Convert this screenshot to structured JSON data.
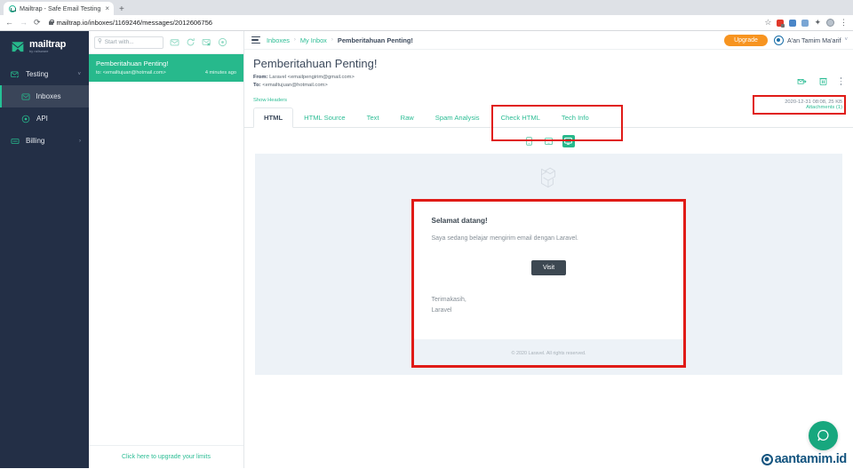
{
  "browser": {
    "tab_title": "Mailtrap - Safe Email Testing",
    "tab_close": "×",
    "new_tab": "+",
    "back": "←",
    "forward": "→",
    "reload": "⟳",
    "url": "mailtrap.io/inboxes/1169246/messages/2012606756",
    "star": "☆",
    "puzzle": "✦",
    "kebab": "⋮",
    "icons": [
      "lock-icon",
      "star-icon",
      "extension-red-icon",
      "extension-blue-icon",
      "extension-person-icon",
      "puzzle-icon",
      "profile-avatar-icon",
      "chrome-menu-icon"
    ]
  },
  "sidebar": {
    "logo_text": "mailtrap",
    "logo_sub": "by railsware",
    "items": [
      {
        "label": "Testing",
        "icon": "envelope-check-icon",
        "caret": "˅",
        "active": false
      },
      {
        "label": "Inboxes",
        "icon": "inbox-envelope-icon",
        "active": true
      },
      {
        "label": "API",
        "icon": "api-target-icon",
        "active": false
      },
      {
        "label": "Billing",
        "icon": "billing-card-icon",
        "caret": "›",
        "active": false
      }
    ]
  },
  "message_list": {
    "search_placeholder": "Start with...",
    "search_value": "",
    "toolbar_icons": [
      "mark-all-read-icon",
      "refresh-icon",
      "delete-all-icon",
      "inbox-settings-icon"
    ],
    "items": [
      {
        "subject": "Pemberitahuan Penting!",
        "recipient": "to: <emailtujuan@hotmail.com>",
        "time": "4 minutes ago"
      }
    ],
    "upgrade_link": "Click here to upgrade your limits"
  },
  "topbar": {
    "breadcrumb": [
      {
        "label": "Inboxes",
        "current": false
      },
      {
        "label": "My Inbox",
        "current": false
      },
      {
        "label": "Pemberitahuan Penting!",
        "current": true
      }
    ],
    "separator": "›",
    "upgrade_label": "Upgrade",
    "user_name": "A'an Tamim Ma'arif",
    "user_caret": "˅"
  },
  "email": {
    "subject": "Pemberitahuan Penting!",
    "from_label": "From:",
    "from_value": "Laravel <emailpengirim@gmail.com>",
    "to_label": "To:",
    "to_value": "<emailtujuan@hotmail.com>",
    "show_headers": "Show Headers",
    "meta_datetime": "2020-12-31 08:08, 25 KB",
    "attachments": "Attachments (1)",
    "action_icons": [
      "forward-icon",
      "trash-icon",
      "more-options-icon"
    ]
  },
  "tabs": [
    {
      "label": "HTML",
      "active": true
    },
    {
      "label": "HTML Source",
      "active": false
    },
    {
      "label": "Text",
      "active": false
    },
    {
      "label": "Raw",
      "active": false
    },
    {
      "label": "Spam Analysis",
      "active": false
    },
    {
      "label": "Check HTML",
      "active": false
    },
    {
      "label": "Tech Info",
      "active": false
    }
  ],
  "device_switcher": [
    {
      "name": "mobile-preview-icon",
      "active": false
    },
    {
      "name": "tablet-preview-icon",
      "active": false
    },
    {
      "name": "desktop-preview-icon",
      "active": true
    }
  ],
  "email_body": {
    "logo": "laravel-logo",
    "heading": "Selamat datang!",
    "paragraph": "Saya sedang belajar mengirim email dengan Laravel.",
    "button_label": "Visit",
    "sign_off_line1": "Terimakasih,",
    "sign_off_line2": "Laravel",
    "footer": "© 2020 Laravel. All rights reserved."
  },
  "overlays": {
    "highlight_color": "#e01b17",
    "help_icon": "chat-help-icon",
    "watermark_text": "aantamim.id"
  },
  "colors": {
    "accent_green": "#2dbd95",
    "sidebar_bg": "#232f46",
    "upgrade_orange": "#f79420",
    "preview_bg": "#edf2f7",
    "dark_button": "#3d4852"
  }
}
